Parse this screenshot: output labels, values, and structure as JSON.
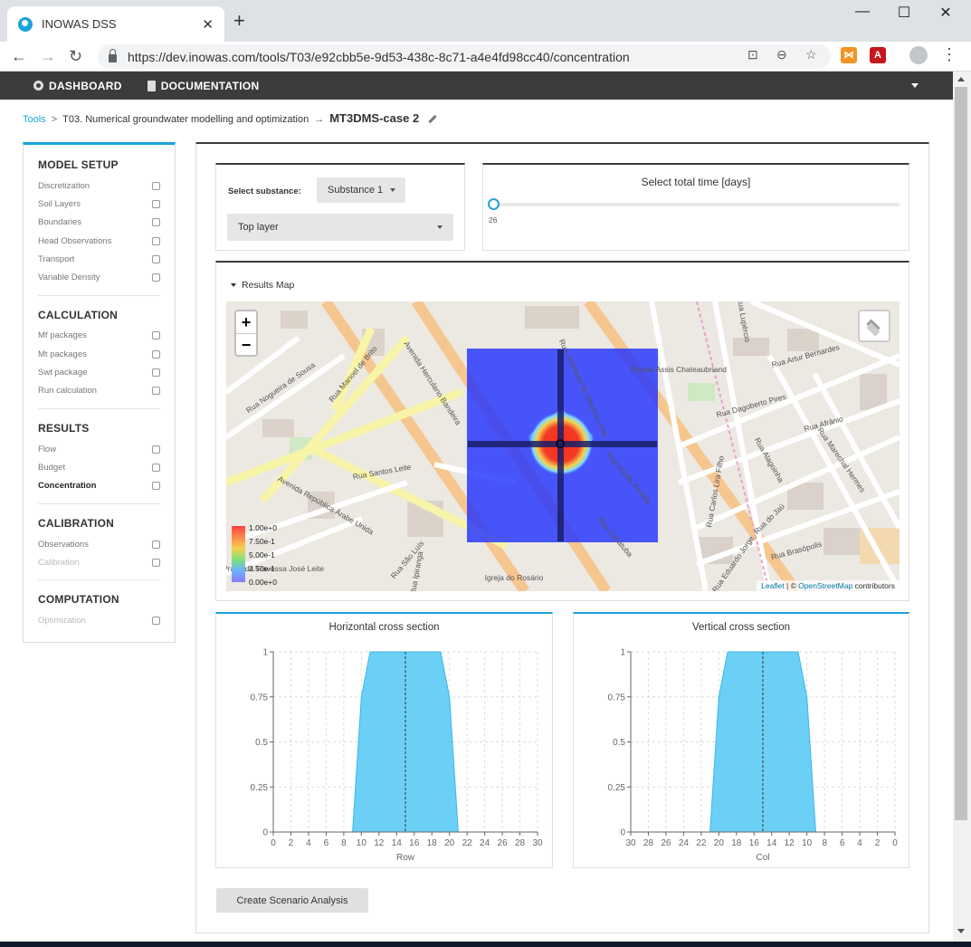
{
  "browser": {
    "tab_title": "INOWAS DSS",
    "tab_close": "✕",
    "new_tab": "+",
    "url": "https://dev.inowas.com/tools/T03/e92cbb5e-9d53-438c-8c71-a4e4fd98cc40/concentration",
    "minimize": "—",
    "maximize": "☐",
    "close": "✕",
    "back": "←",
    "forward": "→",
    "reload": "↻",
    "translate_icon": "⊡",
    "zoom_icon": "⊖",
    "bookmark_icon": "☆",
    "menu_icon": "⋮",
    "ext1": "⋈",
    "ext2": "A",
    "ext_colors": [
      "#f29425",
      "#c4171e"
    ]
  },
  "navbar": {
    "dashboard": "DASHBOARD",
    "documentation": "DOCUMENTATION"
  },
  "breadcrumb": {
    "tools": "Tools",
    "sep1": ">",
    "tool_name": "T03. Numerical groundwater modelling and optimization",
    "sep2": "→",
    "model_name": "MT3DMS-case 2"
  },
  "sidebar": {
    "sections": [
      {
        "heading": "MODEL SETUP",
        "items": [
          "Discretization",
          "Soil Layers",
          "Boundaries",
          "Head Observations",
          "Transport",
          "Variable Density"
        ]
      },
      {
        "heading": "CALCULATION",
        "items": [
          "Mf packages",
          "Mt packages",
          "Swt package",
          "Run calculation"
        ]
      },
      {
        "heading": "RESULTS",
        "items": [
          "Flow",
          "Budget",
          "Concentration"
        ]
      },
      {
        "heading": "CALIBRATION",
        "items": [
          "Observations",
          "Calibration"
        ]
      },
      {
        "heading": "COMPUTATION",
        "items": [
          "Optimization"
        ]
      }
    ],
    "active_item": "Concentration",
    "disabled_items": [
      "Calibration",
      "Optimization"
    ]
  },
  "substance": {
    "label": "Select substance:",
    "selected": "Substance 1",
    "layer": "Top layer"
  },
  "time": {
    "title": "Select total time [days]",
    "value": "26"
  },
  "map": {
    "title": "Results Map",
    "zoom_in": "+",
    "zoom_out": "−",
    "legend": [
      "1.00e+0",
      "7.50e-1",
      "5.00e-1",
      "2.50e-1",
      "0.00e+0"
    ],
    "attribution_leaflet": "Leaflet",
    "attribution_sep": " | © ",
    "attribution_osm": "OpenStreetMap",
    "attribution_rest": " contributors",
    "street_labels": [
      "Avenida Herculano Bandeira",
      "Rua Manoel de Brito",
      "Rua Nogueira de Sousa",
      "Avenida República Árabe Unida",
      "Rua Santos Leite",
      "Rua Artur Bernardes",
      "Rua Dagoberto Pires",
      "Rua Afrânio",
      "Rua Carlos Lira Filho",
      "Rua Eduardo Jorge",
      "Rua Brasópolis",
      "Rua do Jaú",
      "Rua Marechal Hermes",
      "Rua Alagoinha",
      "Rua São Luís",
      "Rua Cacatuba",
      "Rua Adolfo Porteia",
      "Rua Jerônimo de Oliveira Lima",
      "Rua Lupércio",
      "Escola Assis Chateaubriand",
      "Igreja do Rosário",
      "Praça da Travessa José Leite",
      "Rua Ipiranga"
    ]
  },
  "horizontal_chart": {
    "title": "Horizontal cross section",
    "xlabel": "Row"
  },
  "vertical_chart": {
    "title": "Vertical cross section",
    "xlabel": "Col"
  },
  "chart_data": [
    {
      "type": "area",
      "title": "Horizontal cross section",
      "xlabel": "Row",
      "ylabel": "",
      "x": [
        0,
        9,
        10,
        11,
        19,
        20,
        21,
        30
      ],
      "y": [
        0,
        0,
        0.75,
        1,
        1,
        0.75,
        0,
        0
      ],
      "xlim": [
        0,
        30
      ],
      "ylim": [
        0,
        1
      ],
      "xticks": [
        0,
        2,
        4,
        6,
        8,
        10,
        12,
        14,
        16,
        18,
        20,
        22,
        24,
        26,
        28,
        30
      ],
      "yticks": [
        0,
        0.25,
        0.5,
        0.75,
        1
      ],
      "reference_line_x": 15,
      "reversed_x": false,
      "grid": true,
      "color": "#5ccbf5"
    },
    {
      "type": "area",
      "title": "Vertical cross section",
      "xlabel": "Col",
      "ylabel": "",
      "x": [
        30,
        21,
        20,
        19,
        11,
        10,
        9,
        0
      ],
      "y": [
        0,
        0,
        0.75,
        1,
        1,
        0.75,
        0,
        0
      ],
      "xlim": [
        0,
        30
      ],
      "ylim": [
        0,
        1
      ],
      "xticks": [
        30,
        28,
        26,
        24,
        22,
        20,
        18,
        16,
        14,
        12,
        10,
        8,
        6,
        4,
        2,
        0
      ],
      "yticks": [
        0,
        0.25,
        0.5,
        0.75,
        1
      ],
      "reference_line_x": 15,
      "reversed_x": true,
      "grid": true,
      "color": "#5ccbf5"
    }
  ],
  "scenario_button": "Create Scenario Analysis"
}
